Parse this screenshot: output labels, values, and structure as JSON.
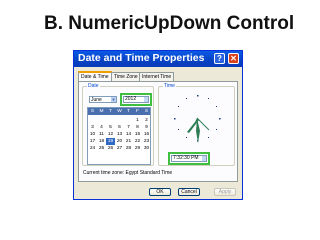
{
  "slide": {
    "title": "B. NumericUpDown Control"
  },
  "window": {
    "title": "Date and Time Properties",
    "help_glyph": "?",
    "close_glyph": "✕",
    "tabs": [
      {
        "label": "Date & Time",
        "active": true
      },
      {
        "label": "Time Zone",
        "active": false
      },
      {
        "label": "Internet Time",
        "active": false
      }
    ],
    "date_group_label": "Date",
    "time_group_label": "Time",
    "month": {
      "value": "June",
      "arrow": "▼"
    },
    "year": {
      "value": "2012"
    },
    "calendar": {
      "weekdays": [
        "S",
        "M",
        "T",
        "W",
        "T",
        "F",
        "S"
      ],
      "weeks": [
        [
          "",
          "",
          "",
          "",
          "",
          "1",
          "2"
        ],
        [
          "3",
          "4",
          "5",
          "6",
          "7",
          "8",
          "9"
        ],
        [
          "10",
          "11",
          "12",
          "13",
          "14",
          "15",
          "16"
        ],
        [
          "17",
          "18",
          "19",
          "20",
          "21",
          "22",
          "23"
        ],
        [
          "24",
          "25",
          "26",
          "27",
          "28",
          "29",
          "30"
        ]
      ],
      "selected_day": "19"
    },
    "time": {
      "value": "7:32:30 PM"
    },
    "time_zone": "Current time zone: Egypt Standard Time",
    "buttons": {
      "ok": "OK",
      "cancel": "Cancel",
      "apply": "Apply"
    },
    "colors": {
      "highlight": "#3fbf3f",
      "title_bar": "#0a5ae6",
      "selected_day": "#316ac5"
    }
  }
}
